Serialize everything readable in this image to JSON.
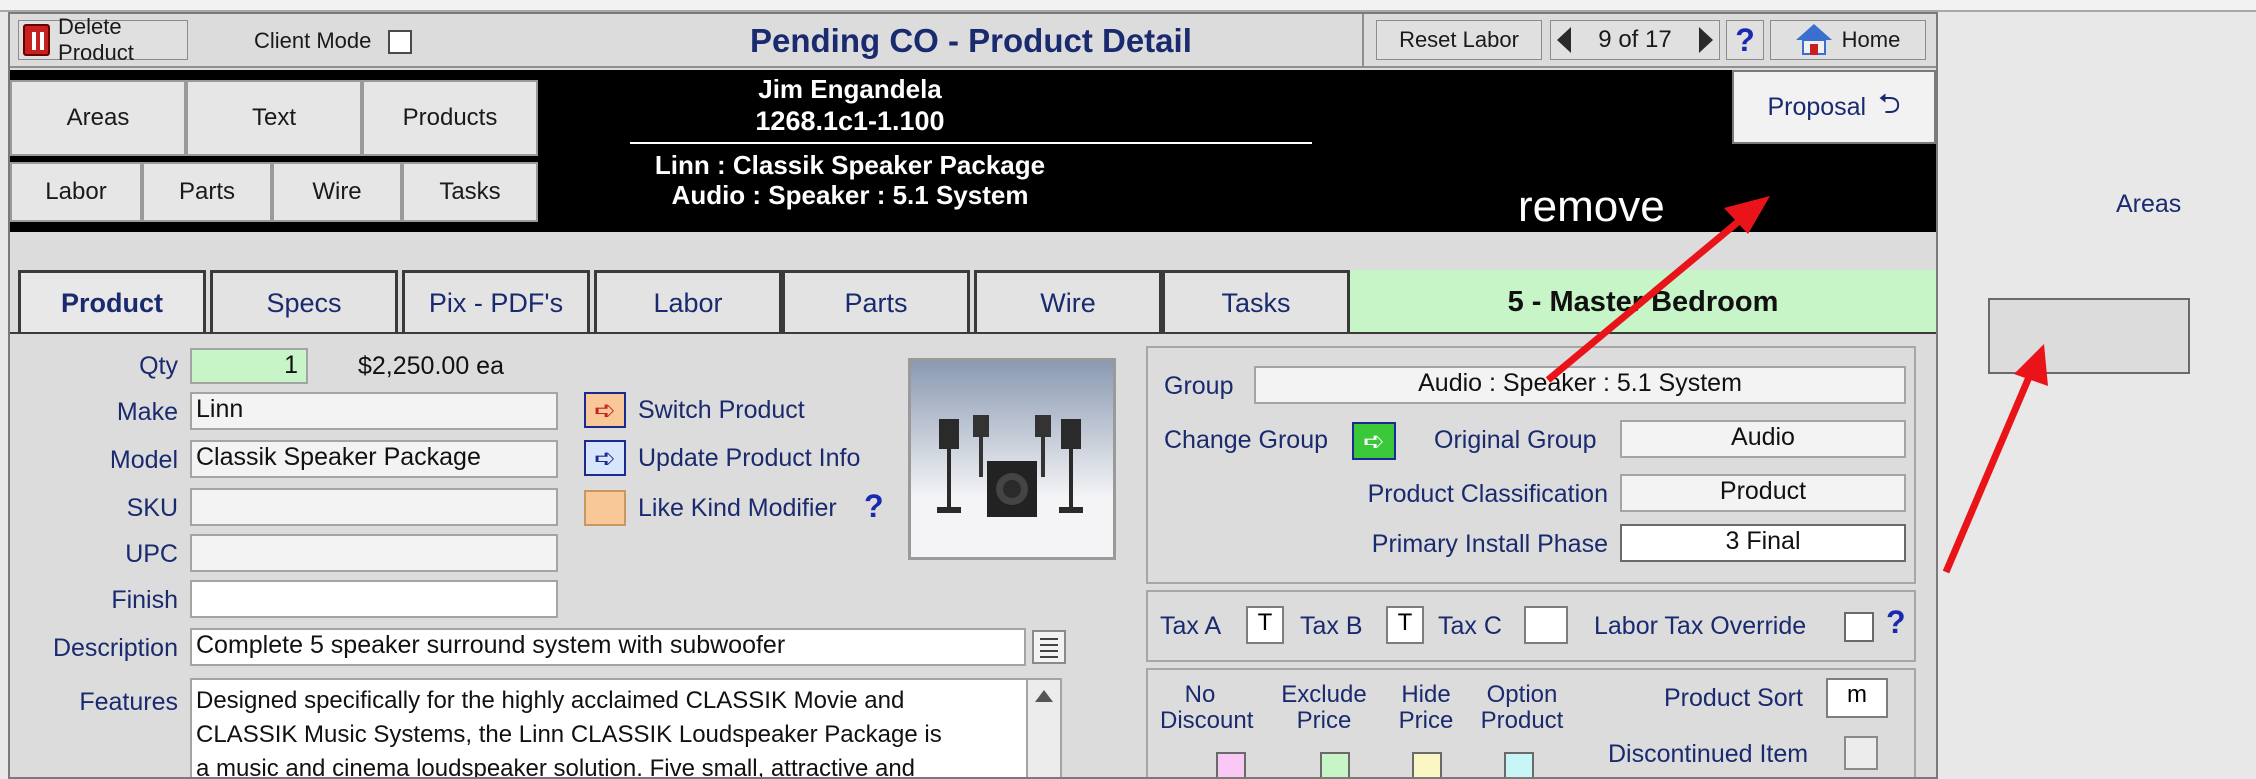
{
  "header": {
    "delete_label": "Delete Product",
    "client_mode_label": "Client Mode",
    "title": "Pending CO - Product Detail",
    "reset_labor": "Reset Labor",
    "record_position": "9 of 17",
    "help_glyph": "?",
    "home_label": "Home"
  },
  "nav_buttons": {
    "areas": "Areas",
    "text": "Text",
    "products": "Products",
    "labor": "Labor",
    "parts": "Parts",
    "wire": "Wire",
    "tasks": "Tasks"
  },
  "customer": {
    "name": "Jim Engandela",
    "project_number": "1268.1c1-1.100",
    "product_line1": "Linn : Classik Speaker Package",
    "product_line2": "Audio : Speaker : 5.1 System"
  },
  "proposal_label": "Proposal",
  "annotation": {
    "remove": "remove"
  },
  "right_panel": {
    "areas_label": "Areas"
  },
  "tabs": [
    {
      "label": "Product"
    },
    {
      "label": "Specs"
    },
    {
      "label": "Pix - PDF's"
    },
    {
      "label": "Labor"
    },
    {
      "label": "Parts"
    },
    {
      "label": "Wire"
    },
    {
      "label": "Tasks"
    }
  ],
  "room_label": "5 - Master Bedroom",
  "product": {
    "qty_label": "Qty",
    "qty_value": "1",
    "price": "$2,250.00 ea",
    "make_label": "Make",
    "make_value": "Linn",
    "model_label": "Model",
    "model_value": "Classik Speaker Package",
    "sku_label": "SKU",
    "sku_value": "",
    "upc_label": "UPC",
    "upc_value": "",
    "finish_label": "Finish",
    "finish_value": "",
    "description_label": "Description",
    "description_value": "Complete 5 speaker surround system with subwoofer",
    "features_label": "Features",
    "features_line1": "Designed specifically for the highly acclaimed CLASSIK Movie and",
    "features_line2": "CLASSIK Music Systems, the Linn CLASSIK Loudspeaker Package is",
    "features_line3": "a music and cinema loudspeaker solution. Five small, attractive and",
    "switch_product": "Switch Product",
    "update_product_info": "Update Product Info",
    "like_kind_modifier": "Like Kind Modifier",
    "help_glyph": "?"
  },
  "group_panel": {
    "group_label": "Group",
    "group_value": "Audio : Speaker : 5.1 System",
    "change_group_label": "Change Group",
    "original_group_label": "Original Group",
    "original_group_value": "Audio",
    "classification_label": "Product Classification",
    "classification_value": "Product",
    "install_phase_label": "Primary Install Phase",
    "install_phase_value": "3 Final"
  },
  "tax_panel": {
    "tax_a_label": "Tax A",
    "tax_a_value": "T",
    "tax_b_label": "Tax B",
    "tax_b_value": "T",
    "tax_c_label": "Tax C",
    "tax_c_value": "",
    "labor_tax_override_label": "Labor Tax Override",
    "help_glyph": "?"
  },
  "flags_panel": {
    "no_discount_line1": "No",
    "no_discount_line2": "Discount",
    "exclude_price_line1": "Exclude",
    "exclude_price_line2": "Price",
    "hide_price_line1": "Hide",
    "hide_price_line2": "Price",
    "option_product_line1": "Option",
    "option_product_line2": "Product",
    "product_sort_label": "Product Sort",
    "product_sort_value": "m",
    "discontinued_label": "Discontinued Item"
  },
  "colors": {
    "title_blue": "#1a2a6e",
    "room_green": "#c8f5c8",
    "qty_green": "#c8f5c8",
    "annotation_red": "#e8141a",
    "no_discount": "#f9c8f5",
    "exclude_price": "#c8f5c8",
    "hide_price": "#fbf7c4",
    "option_product": "#c8f5f5",
    "like_kind_orange": "#f9c898"
  }
}
